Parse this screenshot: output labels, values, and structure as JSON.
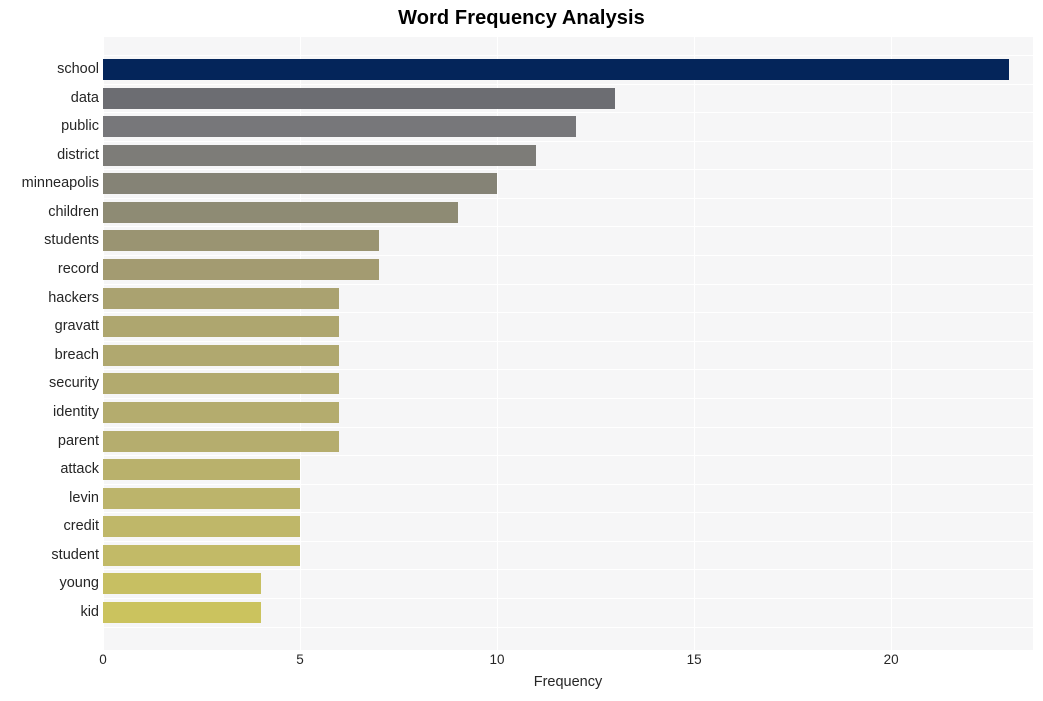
{
  "chart_data": {
    "type": "bar",
    "orientation": "horizontal",
    "title": "Word Frequency Analysis",
    "xlabel": "Frequency",
    "ylabel": "",
    "xlim": [
      0,
      23.6
    ],
    "xticks": [
      0,
      5,
      10,
      15,
      20
    ],
    "xtick_labels": [
      "0",
      "5",
      "10",
      "15",
      "20"
    ],
    "grid": true,
    "grid_axis": "x",
    "legend": false,
    "categories": [
      "school",
      "data",
      "public",
      "district",
      "minneapolis",
      "children",
      "students",
      "record",
      "hackers",
      "gravatt",
      "breach",
      "security",
      "identity",
      "parent",
      "attack",
      "levin",
      "credit",
      "student",
      "young",
      "kid"
    ],
    "values": [
      23,
      13,
      12,
      11,
      10,
      9,
      7,
      7,
      6,
      6,
      6,
      6,
      6,
      6,
      5,
      5,
      5,
      5,
      4,
      4
    ],
    "bar_colors": [
      "#04255a",
      "#6c6d72",
      "#77777a",
      "#7d7c78",
      "#858376",
      "#8e8b74",
      "#9a9472",
      "#a39b71",
      "#aaa270",
      "#aea66f",
      "#b0a86f",
      "#b2aa6e",
      "#b4ac6e",
      "#b5ad6e",
      "#b9b16c",
      "#bcb46b",
      "#bfb769",
      "#c2ba67",
      "#c7bf62",
      "#cbc35e"
    ]
  },
  "figure": {
    "background_color": "#ffffff",
    "plot_background_color": "#f6f6f7",
    "gridline_color": "#ffffff",
    "text_color": "#262626",
    "title_color": "#000000"
  }
}
